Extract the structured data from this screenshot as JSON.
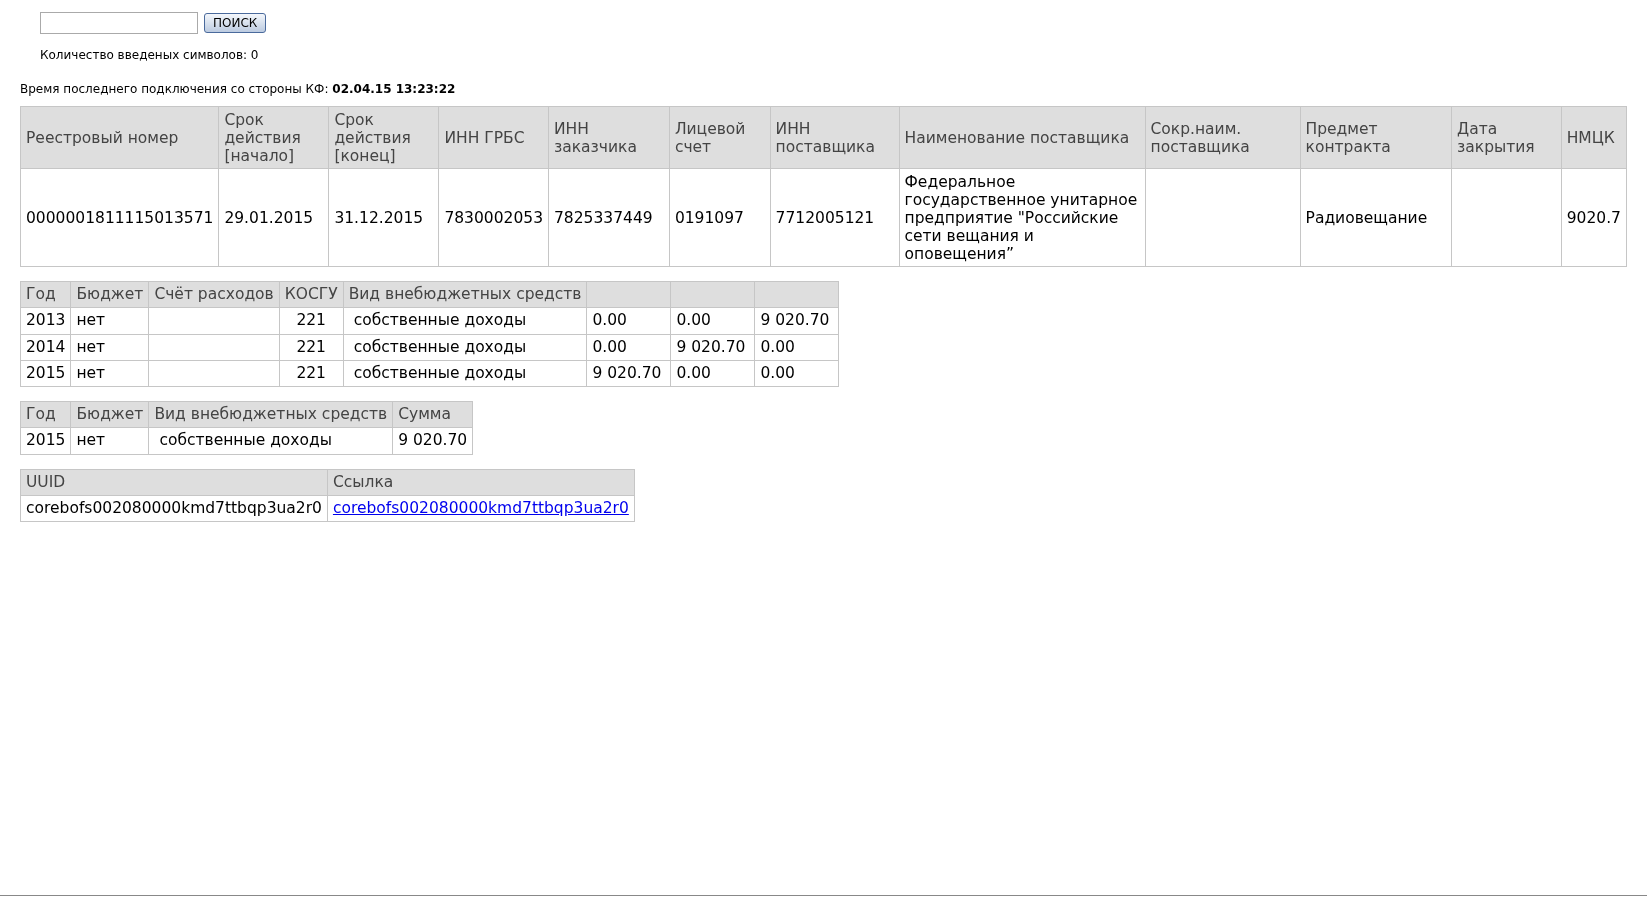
{
  "search": {
    "button": "ПОИСК",
    "counter": "Количество введеных символов: 0"
  },
  "last_connection": "Время последнего подключения со стороны КФ: **02.04.15 13:23:22**",
  "contract_table": {
    "columns": [
      "Реестровый номер",
      "Срок действия [начало]",
      "Срок действия [конец]",
      "ИНН ГРБС",
      "ИНН заказчика",
      "Лицевой счет",
      "ИНН поставщика",
      "Наименование поставщика",
      "Сокр.наим. поставщика",
      "Предмет контракта",
      "Дата закрытия",
      "НМЦК"
    ],
    "rows": [
      [
        "0000001811115013571",
        "29.01.2015",
        "31.12.2015",
        "7830002053",
        "7825337449",
        "0191097",
        "7712005121",
        "Федеральное государственное унитарное предприятие \"Российские сети вещания и оповещения”",
        null,
        "Радиовещание",
        null,
        "9020.7"
      ]
    ]
  },
  "finance_table": {
    "columns": [
      "Год",
      "Бюджет",
      "Счёт расходов",
      "КОСГУ",
      "Вид внебюджетных средств",
      null,
      null,
      null
    ],
    "rows": [
      [
        "2013",
        "нет",
        null,
        "221",
        "собственные доходы",
        "0.00",
        "0.00",
        "9 020.70"
      ],
      [
        "2014",
        "нет",
        null,
        "221",
        "собственные доходы",
        "0.00",
        "9 020.70",
        "0.00"
      ],
      [
        "2015",
        "нет",
        null,
        "221",
        "собственные доходы",
        "9 020.70",
        "0.00",
        "0.00"
      ]
    ]
  },
  "sum_table": {
    "columns": [
      "Год",
      "Бюджет",
      "Вид внебюджетных средств",
      "Сумма"
    ],
    "rows": [
      [
        "2015",
        "нет",
        "собственные доходы",
        "9 020.70"
      ]
    ]
  },
  "uuid_table": {
    "columns": [
      "UUID",
      "Ссылка"
    ],
    "rows": [
      [
        {
          "kind": "text",
          "text": "corebofs002080000kmd7ttbqp3ua2r0"
        },
        {
          "kind": "link",
          "text": "corebofs002080000kmd7ttbqp3ua2r0"
        }
      ]
    ]
  }
}
